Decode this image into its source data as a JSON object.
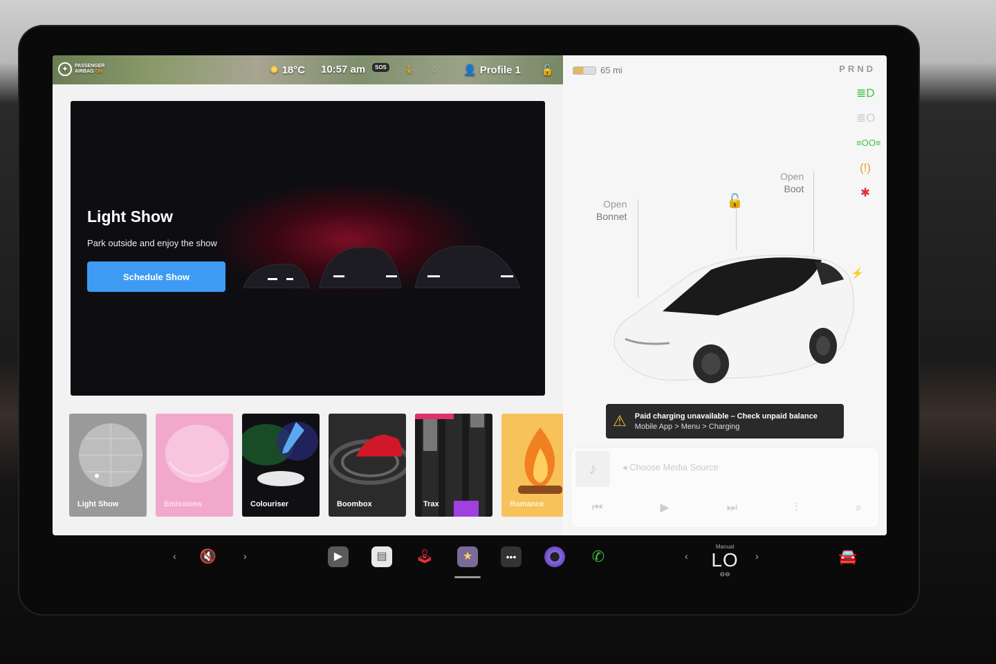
{
  "status_bar": {
    "airbag_line1": "PASSENGER",
    "airbag_line2": "AIRBAG",
    "airbag_state": "ON",
    "temperature": "18°C",
    "time": "10:57 am",
    "sos": "SOS",
    "profile": "Profile 1"
  },
  "vehicle": {
    "range": "65 mi",
    "gear_selector": "PRND",
    "bonnet_open": "Open",
    "bonnet_label": "Bonnet",
    "boot_open": "Open",
    "boot_label": "Boot"
  },
  "alert": {
    "title": "Paid charging unavailable – Check unpaid balance",
    "path": "Mobile App > Menu > Charging"
  },
  "media": {
    "source_placeholder": "Choose Media Source"
  },
  "hero": {
    "title": "Light Show",
    "subtitle": "Park outside and enjoy the show",
    "button": "Schedule Show"
  },
  "tiles": [
    {
      "label": "Light Show"
    },
    {
      "label": "Emissions"
    },
    {
      "label": "Colouriser"
    },
    {
      "label": "Boombox"
    },
    {
      "label": "Trax"
    },
    {
      "label": "Romance"
    }
  ],
  "climate": {
    "mode": "Manual",
    "temp": "LO"
  },
  "colors": {
    "accent_blue": "#3e9bf3",
    "indicator_green": "#3ec23e",
    "warning_orange": "#f0a020",
    "seatbelt_red": "#e0303c"
  },
  "icons": [
    "airbag-icon",
    "sun-icon",
    "download-icon",
    "profile-icon",
    "lock-icon",
    "headlight-icon",
    "fog-light-icon",
    "parking-light-icon",
    "tyre-pressure-icon",
    "seatbelt-icon",
    "charge-icon",
    "warning-icon",
    "music-note-icon",
    "previous-icon",
    "play-icon",
    "next-icon",
    "equalizer-icon",
    "search-icon",
    "mute-icon",
    "theater-icon",
    "toybox-icon",
    "arcade-icon",
    "apps-icon",
    "more-icon",
    "camera-icon",
    "phone-icon",
    "car-icon"
  ]
}
